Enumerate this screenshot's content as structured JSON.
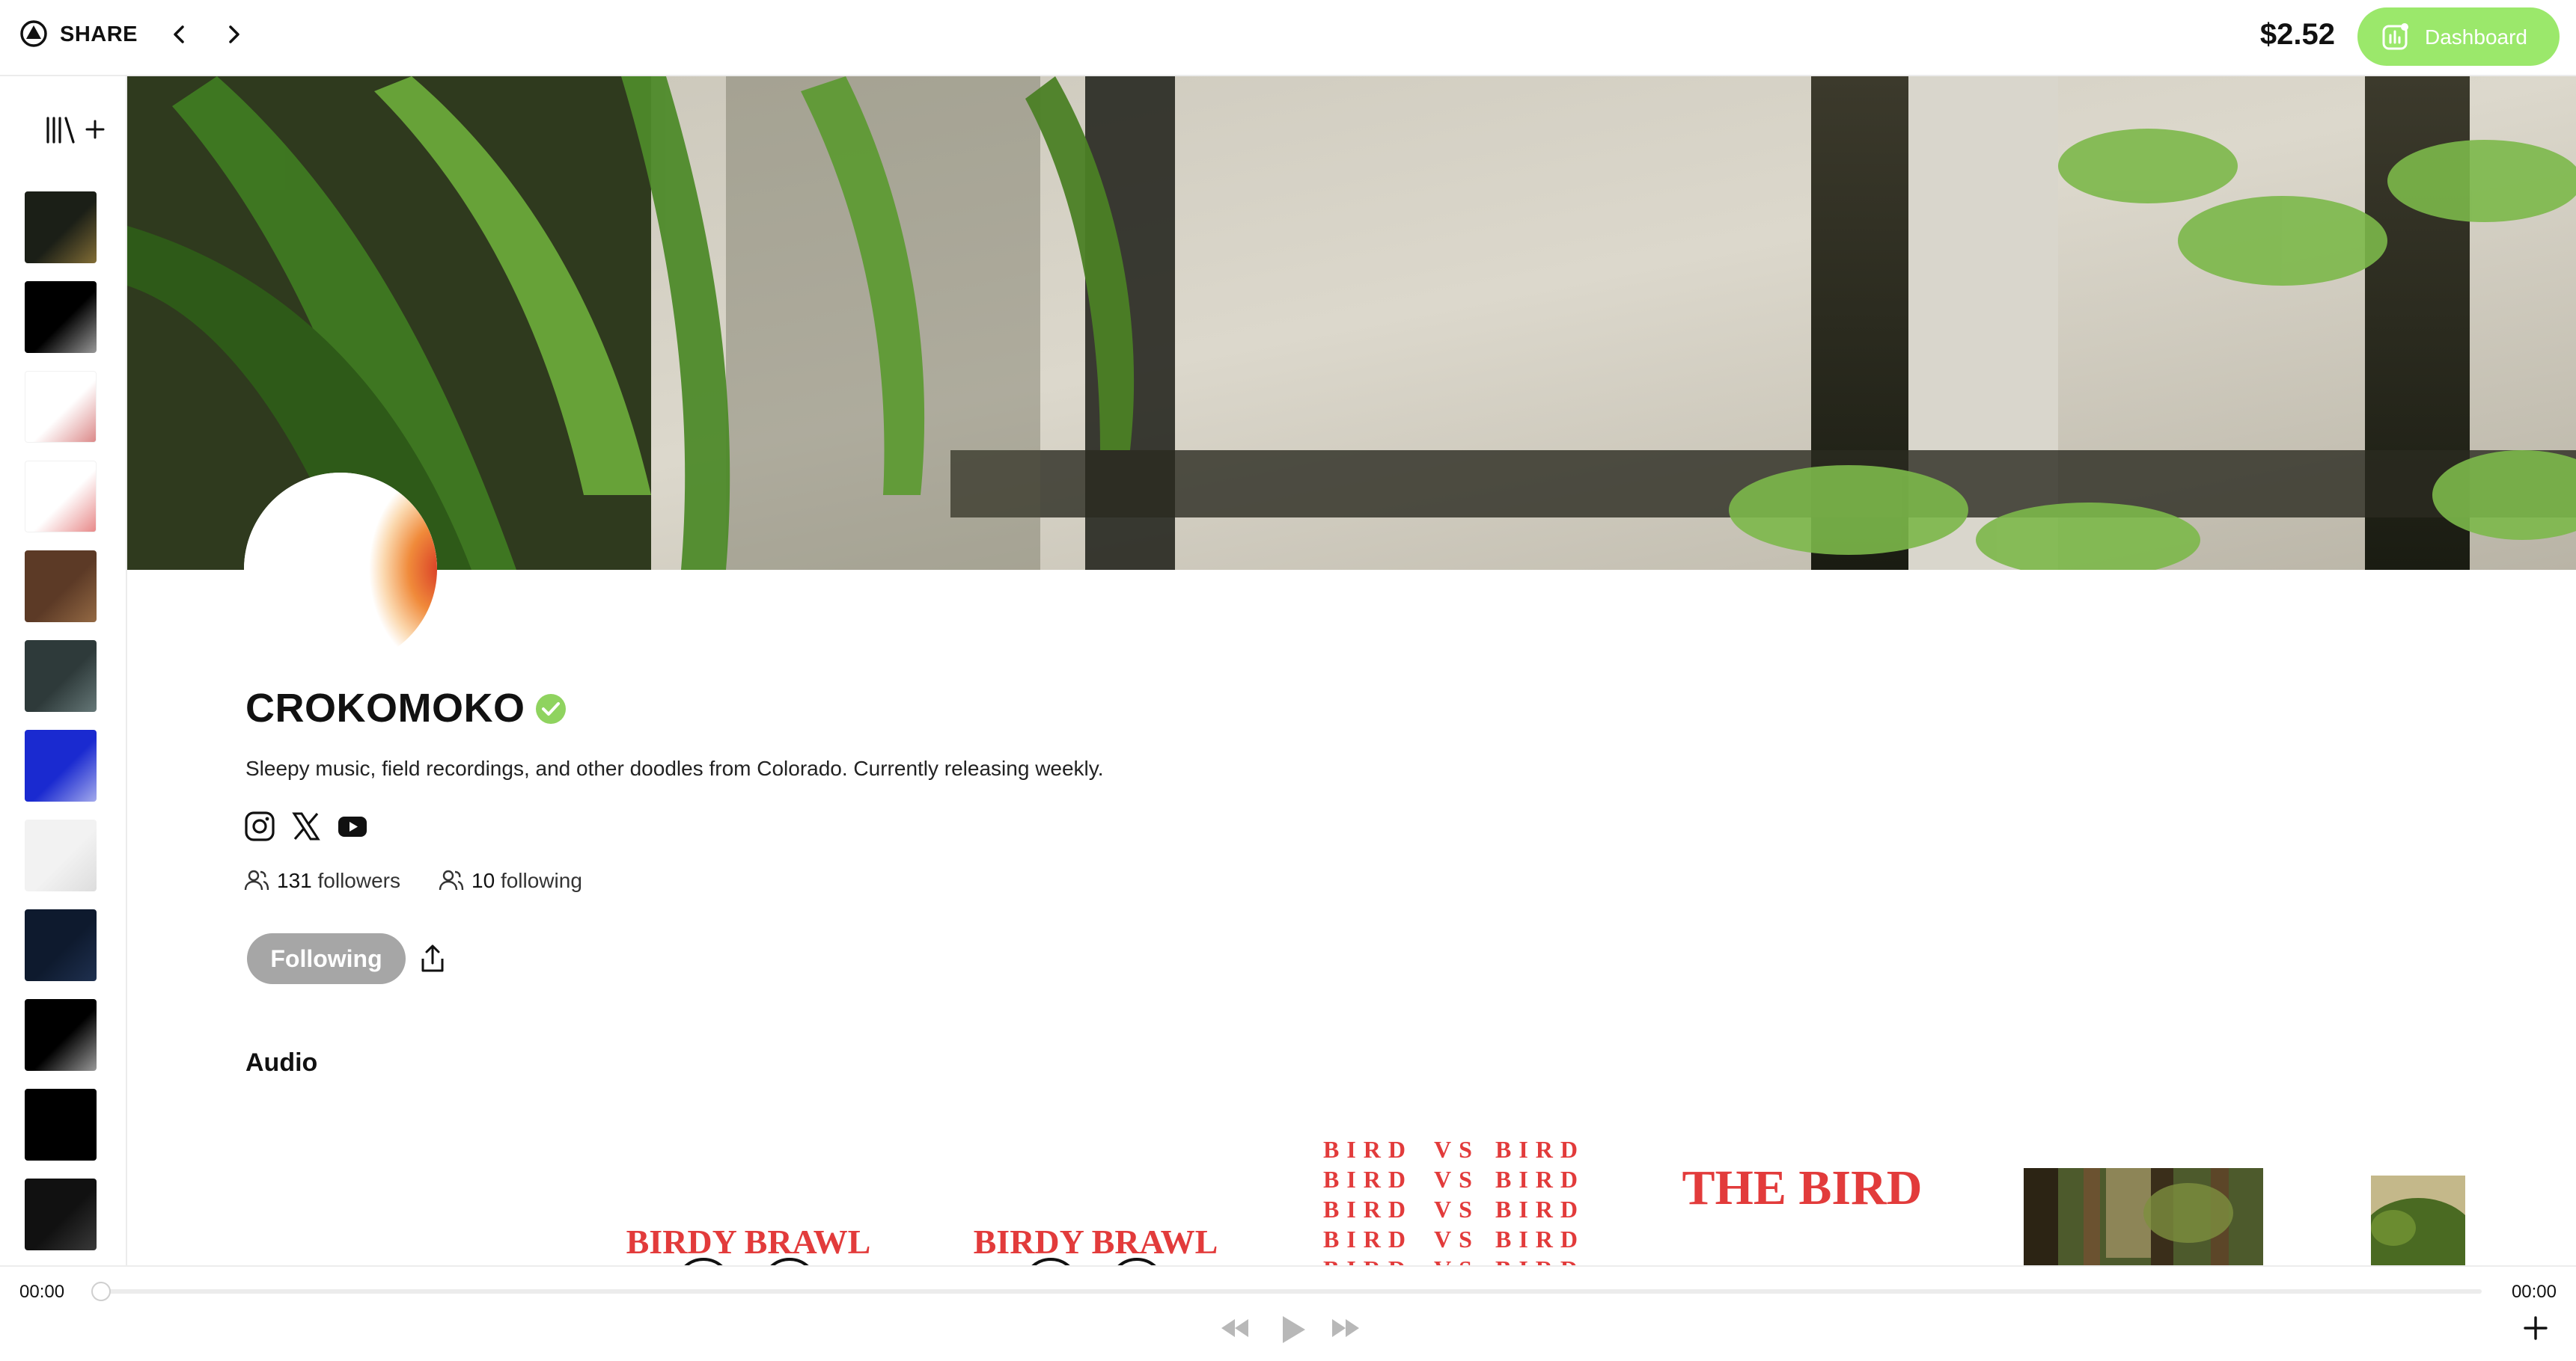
{
  "header": {
    "brand": "SHARE",
    "balance": "$2.52",
    "dashboard_label": "Dashboard",
    "accent": "#9be86b"
  },
  "sidebar": {
    "library_icon": "library-icon",
    "add_icon": "plus-icon",
    "items": [
      {
        "name": "release-1",
        "colors": [
          "#1b1f17",
          "#c8a24a"
        ]
      },
      {
        "name": "release-2",
        "colors": [
          "#000000",
          "#ffffff"
        ]
      },
      {
        "name": "release-3",
        "colors": [
          "#ffffff",
          "#c43a3a"
        ]
      },
      {
        "name": "release-4",
        "colors": [
          "#ffffff",
          "#d83a3a"
        ]
      },
      {
        "name": "release-5",
        "colors": [
          "#5c3a26",
          "#b98958"
        ]
      },
      {
        "name": "release-6",
        "colors": [
          "#2e3a3a",
          "#8aa0a0"
        ]
      },
      {
        "name": "release-7",
        "colors": [
          "#1a2ad0",
          "#ffffff"
        ]
      },
      {
        "name": "release-8",
        "colors": [
          "#f2f2f2",
          "#cfcfcf"
        ]
      },
      {
        "name": "release-9",
        "colors": [
          "#0e1a2e",
          "#2a3f66"
        ]
      },
      {
        "name": "release-10",
        "colors": [
          "#000000",
          "#ffffff"
        ]
      },
      {
        "name": "release-11",
        "colors": [
          "#000000",
          "#000000"
        ]
      },
      {
        "name": "release-12",
        "colors": [
          "#111111",
          "#555555"
        ]
      }
    ]
  },
  "profile": {
    "name": "CROKOMOKO",
    "bio": "Sleepy music, field recordings, and other doodles from Colorado. Currently releasing weekly.",
    "social": [
      "instagram-icon",
      "x-icon",
      "youtube-icon"
    ],
    "followers_count": "131",
    "followers_label": "followers",
    "following_count": "10",
    "following_label": "following",
    "follow_button": "Following",
    "verified_color": "#8fd35f"
  },
  "audio": {
    "section_title": "Audio",
    "cards": [
      {
        "title": "BIRDY BRAWL"
      },
      {
        "title": "BIRDY BRAWL"
      },
      {
        "lines": [
          "BIRD",
          "VS",
          "BIRD"
        ]
      },
      {
        "title": "THE BIRD"
      },
      {
        "name": "forest-photo"
      },
      {
        "name": "shrub-photo"
      }
    ],
    "accent_red": "#e23b3b"
  },
  "player": {
    "elapsed": "00:00",
    "duration": "00:00"
  }
}
